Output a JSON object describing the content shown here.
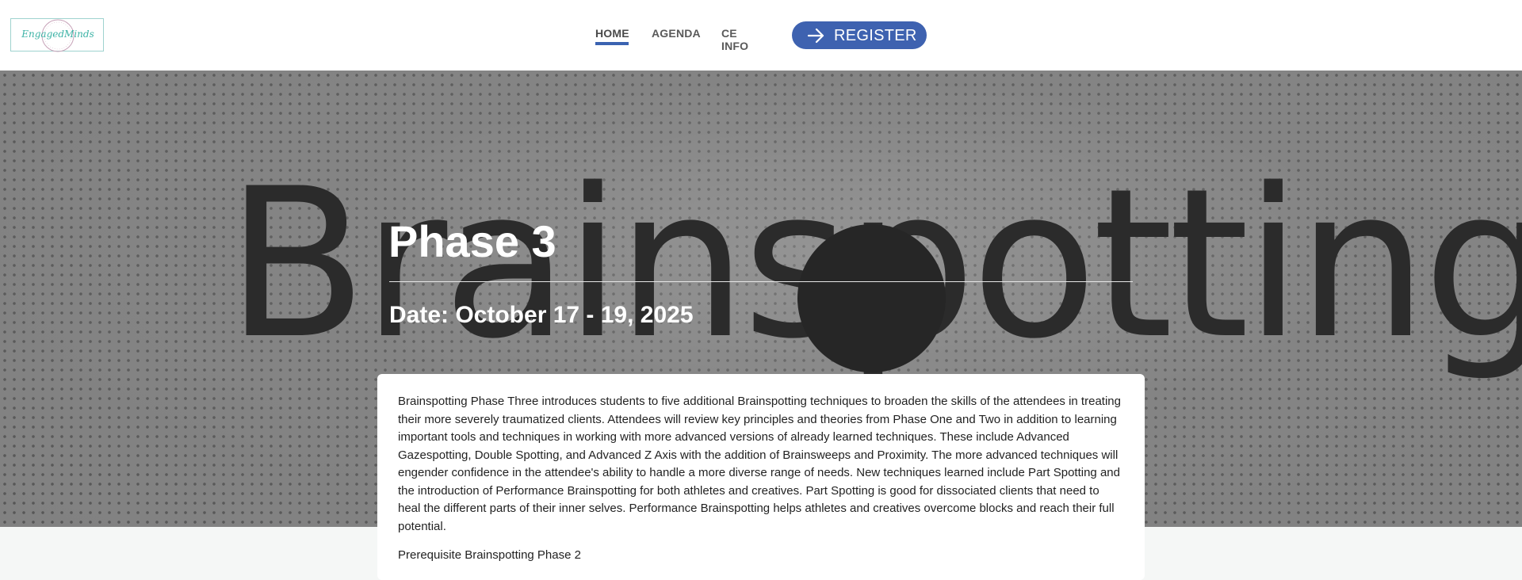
{
  "header": {
    "logo_text": "EngagedMinds",
    "nav": [
      {
        "label": "HOME",
        "active": true
      },
      {
        "label": "AGENDA"
      },
      {
        "label": "CE INFO"
      }
    ],
    "register_label": "REGISTER",
    "accent_color": "#3e62b0"
  },
  "hero": {
    "background_word": "Brainspotting",
    "title": "Phase 3",
    "date": "Date: October 17 - 19, 2025"
  },
  "content": {
    "description": "Brainspotting Phase Three introduces students to five additional Brainspotting techniques to broaden the skills of the attendees in treating their more severely traumatized clients. Attendees will review key principles and theories from Phase One and Two in addition to learning important tools and techniques in working with more advanced versions of already learned techniques. These include Advanced Gazespotting, Double Spotting, and Advanced Z Axis with the addition of Brainsweeps and Proximity. The more advanced techniques will engender confidence in the attendee's ability to handle a more diverse range of needs. New techniques learned include Part Spotting and the introduction of Performance Brainspotting for both athletes and creatives. Part Spotting is good for dissociated clients that need to heal the different parts of their inner selves. Performance Brainspotting helps athletes and creatives overcome blocks and reach their full potential.",
    "prerequisite": "Prerequisite Brainspotting Phase 2"
  }
}
